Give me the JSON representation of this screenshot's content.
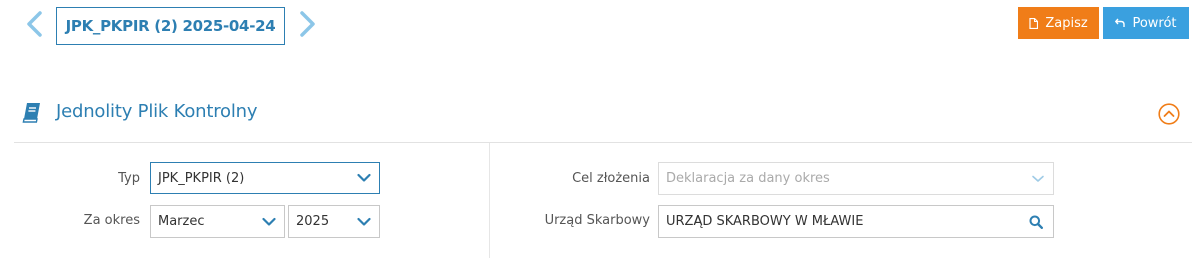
{
  "header": {
    "document_title": "JPK_PKPIR (2) 2025-04-24",
    "save_label": "Zapisz",
    "back_label": "Powrót"
  },
  "section": {
    "title": "Jednolity Plik Kontrolny"
  },
  "form": {
    "type_label": "Typ",
    "type_value": "JPK_PKPIR (2)",
    "period_label": "Za okres",
    "month_value": "Marzec",
    "year_value": "2025",
    "purpose_label": "Cel złożenia",
    "purpose_value": "Deklaracja za dany okres",
    "office_label": "Urząd Skarbowy",
    "office_value": "URZĄD SKARBOWY W MŁAWIE"
  },
  "colors": {
    "primary": "#2d7fb2",
    "save": "#f07d18",
    "back": "#3aa0df",
    "collapse": "#f07d18"
  }
}
